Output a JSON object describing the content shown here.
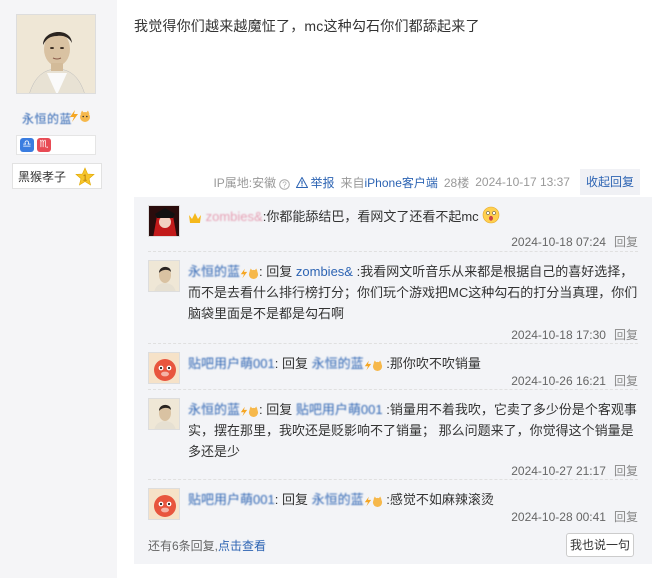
{
  "author": {
    "name": "永恒的蓝",
    "level_title": "黑猴孝子",
    "level_num": "1"
  },
  "post": {
    "text": "我觉得你们越来越魔怔了，mc这种勾石你们都舔起来了",
    "ip": "IP属地:安徽",
    "report": "举报",
    "client_prefix": "来自",
    "client": "iPhone客户端",
    "floor": "28楼",
    "time": "2024-10-17 13:37",
    "collapse": "收起回复"
  },
  "replies": [
    {
      "user": "zombies&",
      "reply_to_label": "",
      "reply_to": "",
      "text": ":你都能舔结巴，看网文了还看不起mc",
      "time": "2024-10-18 07:24",
      "reply_label": "回复"
    },
    {
      "user": "永恒的蓝",
      "reply_to_label": "回复",
      "reply_to": "zombies&",
      "text": ":我看网文听音乐从来都是根据自己的喜好选择，而不是去看什么排行榜打分；你们玩个游戏把MC这种勾石的打分当真理，你们脑袋里面是不是都是勾石啊",
      "time": "2024-10-18 17:30",
      "reply_label": "回复"
    },
    {
      "user": "贴吧用户萌001",
      "reply_to_label": "回复",
      "reply_to": "永恒的蓝",
      "text": ":那你吹不吹销量",
      "time": "2024-10-26 16:21",
      "reply_label": "回复"
    },
    {
      "user": "永恒的蓝",
      "reply_to_label": "回复",
      "reply_to": "贴吧用户萌001",
      "text": ":销量用不着我吹，它卖了多少份是个客观事实，摆在那里，我吹还是贬影响不了销量； 那么问题来了，你觉得这个销量是多还是少",
      "time": "2024-10-27 21:17",
      "reply_label": "回复"
    },
    {
      "user": "贴吧用户萌001",
      "reply_to_label": "回复",
      "reply_to": "永恒的蓝",
      "text": ":感觉不如麻辣滚烫",
      "time": "2024-10-28 00:41",
      "reply_label": "回复"
    }
  ],
  "footer": {
    "more_text": "还有6条回复,",
    "more_link": "点击查看",
    "say_button": "我也说一句"
  }
}
